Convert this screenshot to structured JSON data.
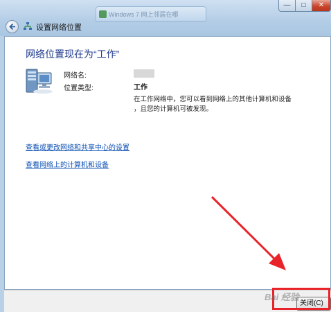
{
  "window": {
    "title": "设置网络位置",
    "background_tab": "Windows 7 网上邻居在哪",
    "min_label": "—",
    "max_label": "□",
    "close_label": "✕"
  },
  "main": {
    "heading": "网络位置现在为“工作”",
    "network_name_label": "网络名:",
    "location_type_label": "位置类型:",
    "location_type_value": "工作",
    "description_line1": "在工作网络中，您可以看到网络上的其他计算机和设备",
    "description_line2": "，且您的计算机可被发现。",
    "link_network_settings": "查看或更改网络和共享中心的设置",
    "link_view_devices": "查看网络上的计算机和设备"
  },
  "footer": {
    "close_button": "关闭(C)"
  },
  "overlay": {
    "watermark": "Bai 经验",
    "accent_color": "#e8242a"
  }
}
